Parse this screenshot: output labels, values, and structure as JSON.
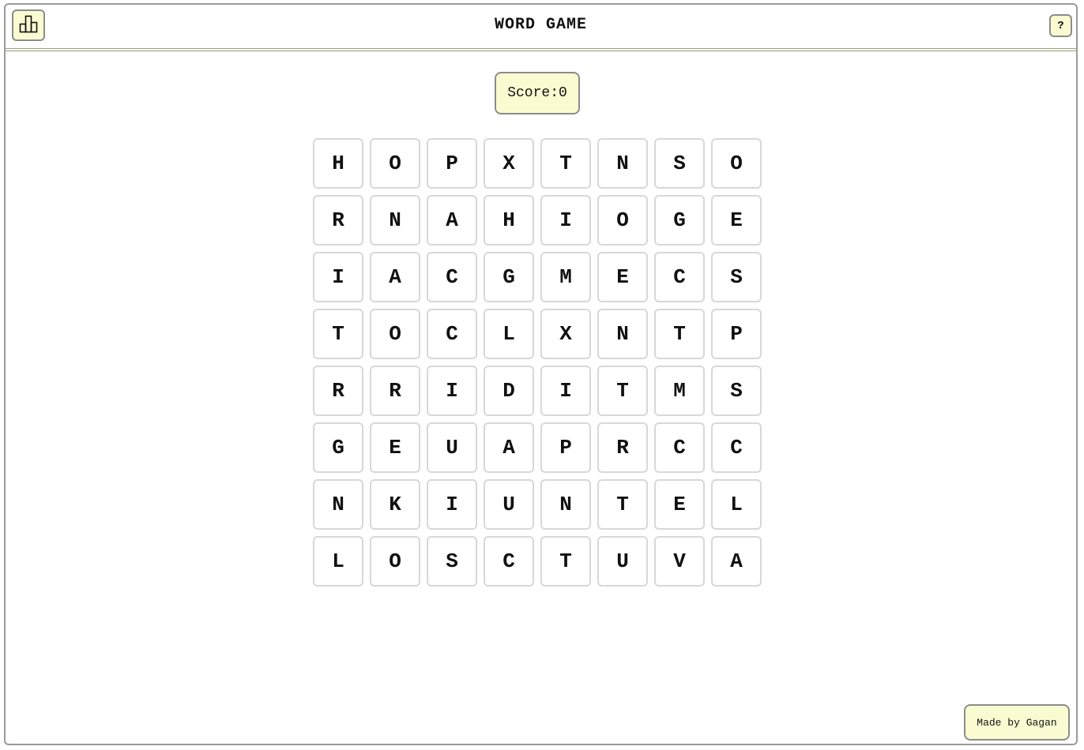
{
  "header": {
    "title": "WORD GAME",
    "stats_icon": "bar-chart-icon",
    "help_label": "?"
  },
  "score": {
    "text": "Score:0"
  },
  "grid": {
    "rows": [
      [
        "H",
        "O",
        "P",
        "X",
        "T",
        "N",
        "S",
        "O"
      ],
      [
        "R",
        "N",
        "A",
        "H",
        "I",
        "O",
        "G",
        "E"
      ],
      [
        "I",
        "A",
        "C",
        "G",
        "M",
        "E",
        "C",
        "S"
      ],
      [
        "T",
        "O",
        "C",
        "L",
        "X",
        "N",
        "T",
        "P"
      ],
      [
        "R",
        "R",
        "I",
        "D",
        "I",
        "T",
        "M",
        "S"
      ],
      [
        "G",
        "E",
        "U",
        "A",
        "P",
        "R",
        "C",
        "C"
      ],
      [
        "N",
        "K",
        "I",
        "U",
        "N",
        "T",
        "E",
        "L"
      ],
      [
        "L",
        "O",
        "S",
        "C",
        "T",
        "U",
        "V",
        "A"
      ]
    ]
  },
  "footer": {
    "credit": "Made by Gagan"
  },
  "colors": {
    "accent": "#fbfbd2",
    "border": "#8c8c8c",
    "tile_border": "#d8d8d8"
  }
}
